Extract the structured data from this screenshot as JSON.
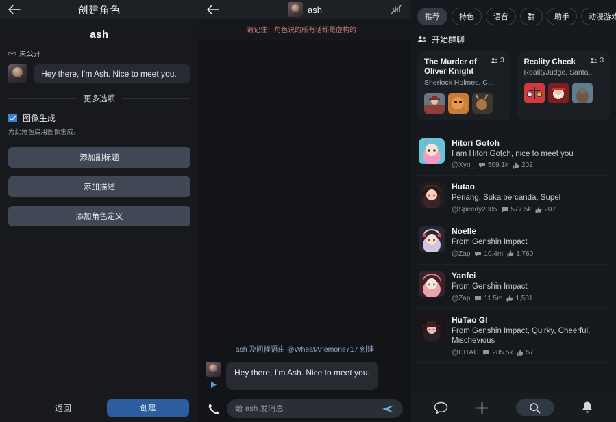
{
  "left_panel": {
    "back_icon": "back-arrow-icon",
    "title": "创建角色",
    "character_name": "ash",
    "visibility_icon": "link-icon",
    "visibility_label": "未公开",
    "greeting_avatar": "ash-avatar",
    "greeting_text": "Hey there, I'm Ash. Nice to meet you.",
    "more_options_label": "更多选项",
    "image_gen": {
      "checked": true,
      "label": "图像生成",
      "sublabel": "为此角色启用图像生成。"
    },
    "buttons": [
      {
        "label": "添加副标题",
        "name": "add-subtitle-button"
      },
      {
        "label": "添加描述",
        "name": "add-description-button"
      },
      {
        "label": "添加角色定义",
        "name": "add-character-definition-button"
      }
    ],
    "footer": {
      "back_label": "返回",
      "create_label": "创建",
      "create_color": "#2c5d9e"
    }
  },
  "middle_panel": {
    "back_icon": "back-arrow-icon",
    "avatar": "ash-avatar",
    "name": "ash",
    "right_icon": "voice-muted-icon",
    "warning": "请记住：角色说的所有话都是虚构的！",
    "warning_color": "#c17a7a",
    "system_note": "ash 及问候语由 @WheatAnemone717 创建",
    "message": {
      "avatar": "ash-avatar",
      "play_icon": "play-icon",
      "text": "Hey there, I'm Ash. Nice to meet you."
    },
    "input": {
      "phone_icon": "phone-icon",
      "placeholder": "给 ash 发消息",
      "value": "",
      "send_icon": "send-icon"
    }
  },
  "right_panel": {
    "chips": [
      {
        "label": "推荐",
        "active": true
      },
      {
        "label": "特色",
        "active": false
      },
      {
        "label": "语音",
        "active": false
      },
      {
        "label": "群",
        "active": false
      },
      {
        "label": "助手",
        "active": false
      },
      {
        "label": "动漫游戏角色",
        "active": false
      }
    ],
    "section": {
      "icon": "people-icon",
      "title": "开始群聊"
    },
    "group_cards": [
      {
        "title": "The Murder of Oliver Knight",
        "subtitle": "Sherlock Holmes, C...",
        "member_icon": "people-icon",
        "member_count": "3",
        "avatars": [
          "detective-avatar",
          "squirrel-avatar",
          "deer-avatar"
        ]
      },
      {
        "title": "Reality Check",
        "subtitle": "RealityJudge, Santa...",
        "member_icon": "people-icon",
        "member_count": "3",
        "avatars": [
          "scales-avatar",
          "santa-avatar",
          "bigfoot-avatar"
        ]
      }
    ],
    "characters": [
      {
        "name": "Hitori Gotoh",
        "desc": "I am Hitori Gotoh, nice to meet you",
        "author": "@Xyn_",
        "chats": "509.1k",
        "likes": "202",
        "avatar": "hitori-gotoh-avatar"
      },
      {
        "name": "Hutao",
        "desc": "Periang, Suka bercanda, Supel",
        "author": "@Speedy2005",
        "chats": "577.5k",
        "likes": "207",
        "avatar": "hutao-avatar"
      },
      {
        "name": "Noelle",
        "desc": "From Genshin Impact",
        "author": "@Zap",
        "chats": "10.4m",
        "likes": "1,760",
        "avatar": "noelle-avatar"
      },
      {
        "name": "Yanfei",
        "desc": "From Genshin Impact",
        "author": "@Zap",
        "chats": "11.5m",
        "likes": "1,581",
        "avatar": "yanfei-avatar"
      },
      {
        "name": "HuTao GI",
        "desc": "From Genshin Impact, Quirky, Cheerful, Mischevious",
        "author": "@CITAC",
        "chats": "285.5k",
        "likes": "57",
        "avatar": "hutao-gi-avatar"
      }
    ],
    "bottom_nav": [
      {
        "icon": "chat-bubble-icon",
        "active": false
      },
      {
        "icon": "plus-icon",
        "active": false
      },
      {
        "icon": "search-icon",
        "active": true
      },
      {
        "icon": "bell-icon",
        "active": false
      }
    ]
  }
}
